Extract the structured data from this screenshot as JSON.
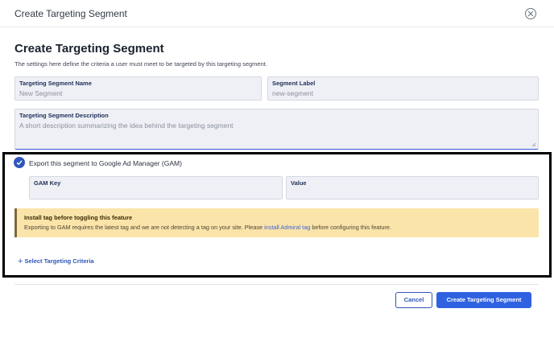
{
  "header": {
    "title": "Create Targeting Segment"
  },
  "form": {
    "title": "Create Targeting Segment",
    "description": "The settings here define the criteria a user must meet to be targeted by this targeting segment.",
    "name_field": {
      "label": "Targeting Segment Name",
      "placeholder": "New Segment"
    },
    "label_field": {
      "label": "Segment Label",
      "placeholder": "new-segment"
    },
    "description_field": {
      "label": "Targeting Segment Description",
      "placeholder": "A short description summarizing the idea behind the targeting segment"
    },
    "gam_export": {
      "label": "Export this segment to Google Ad Manager (GAM)",
      "checked": true
    },
    "gam_key_field": {
      "label": "GAM Key",
      "value": ""
    },
    "gam_value_field": {
      "label": "Value",
      "value": ""
    },
    "alert": {
      "title": "Install tag before toggling this feature",
      "text_before": "Exporting to GAM requires the latest tag and we are not detecting a tag on your site. Please ",
      "link": "install Admiral tag",
      "text_after": " before configuring this feature."
    },
    "criteria_link": "Select Targeting Criteria"
  },
  "footer": {
    "cancel": "Cancel",
    "submit": "Create Targeting Segment"
  },
  "colors": {
    "primary": "#2f62e0",
    "alert_bg": "#fbe4a9",
    "field_bg": "#eef0f5"
  },
  "icons": {
    "close": "close-circle-icon",
    "check": "check-circle-icon",
    "plus": "plus-icon",
    "resize": "resize-grip-icon"
  }
}
